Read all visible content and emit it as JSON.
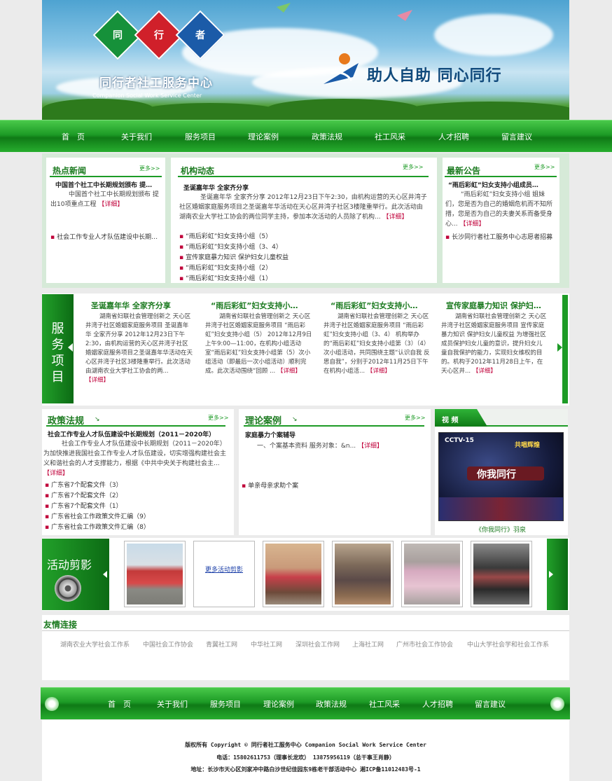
{
  "banner": {
    "logo_chars": [
      "同",
      "行",
      "者"
    ],
    "logo_cn": "同行者社工服务中心",
    "logo_en": "Companion Social Work Service Center",
    "slogan": "助人自助  同心同行"
  },
  "nav": {
    "items": [
      "首　页",
      "关于我们",
      "服务项目",
      "理论案例",
      "政策法规",
      "社工风采",
      "人才招聘",
      "留言建议"
    ]
  },
  "nav2": {
    "items": [
      "首　页",
      "关于我们",
      "服务项目",
      "理论案例",
      "政策法规",
      "社工风采",
      "人才招聘",
      "留言建议"
    ]
  },
  "more": "更多>>",
  "hot_news": {
    "title": "热点新闻",
    "headline": "中国首个社工中长期规划颁布  提…",
    "summary": "中国首个社工中长期规划颁布 提出10项重点工程",
    "detail": "【详细】",
    "items": [
      "社会工作专业人才队伍建设中长期…"
    ]
  },
  "org_news": {
    "title": "机构动态",
    "headline": "圣诞嘉年华  全家齐分享",
    "summary": "圣诞嘉年华  全家齐分享    2012年12月23日下午2:30，由机构运营的天心区井湾子社区婚姻家庭服务项目之圣诞嘉年华活动在天心区井湾子社区3楼隆重举行。此次活动由湖南农业大学社工协会的两位同学主持，参加本次活动的人员除了机构...",
    "detail": "【详细】",
    "items": [
      "“雨后彩虹”妇女支持小组（5）",
      "“雨后彩虹”妇女支持小组（3、4）",
      "宣传家庭暴力知识  保护妇女儿童权益",
      "“雨后彩虹”妇女支持小组（2）",
      "“雨后彩虹”妇女支持小组（1）"
    ]
  },
  "notice": {
    "title": "最新公告",
    "headline": "“雨后彩虹”妇女支持小组成员…",
    "summary": "“雨后彩虹”妇女支持小组  姐妹们，您是否为自己的婚姻危机而不知所措，您是否为自己的夫妻关系而备受身心...",
    "detail": "【详细】",
    "items": [
      "长沙同行者社工服务中心志愿者招募"
    ]
  },
  "services": {
    "label": "服务项目",
    "cards": [
      {
        "title": "圣诞嘉年华  全家齐分享",
        "text": "湖南省妇联社会管理创新之 天心区井湾子社区婚姻家庭服务项目 圣诞嘉年华   全家齐分享  2012年12月23日下午2:30，由机构运营的天心区井湾子社区婚姻家庭服务项目之圣诞嘉年华活动在天心区井湾子社区3楼隆重举行。此次活动由湖南农业大学社工协会的两...",
        "detail": "【详细】"
      },
      {
        "title": "“雨后彩虹”妇女支持小…",
        "text": "湖南省妇联社会管理创新之 天心区井湾子社区婚姻家庭服务项目 “雨后彩虹”妇女支持小组（5） 2012年12月9日上午9:00—11:00，在机构小组活动室“雨后彩虹”妇女支持小组第（5）次小组活动（即最后一次小组活动）顺利完成。此次活动围绕“回顾 ...",
        "detail": "【详细】"
      },
      {
        "title": "“雨后彩虹”妇女支持小…",
        "text": "湖南省妇联社会管理创新之 天心区井湾子社区婚姻家庭服务项目 “雨后彩虹”妇女支持小组（3、4） 机构举办的“雨后彩虹”妇女支持小组第（3）（4）次小组活动，共同围绕主题“认识自我  反思自我”，分别于2012年11月25日下午在机构小组活...",
        "detail": "【详细】"
      },
      {
        "title": "宣传家庭暴力知识  保护妇…",
        "text": "湖南省妇联社会管理创新之 天心区井湾子社区婚姻家庭服务项目 宣传家庭暴力知识      保护妇女儿童权益 为增强社区成员保护妇女儿童的意识，提升妇女儿童自我保护的能力，实现妇女维权的目的。机构于2012年11月28日上午，在天心区井...",
        "detail": "【详细】"
      }
    ]
  },
  "policy": {
    "title": "政策法规",
    "headline": "社会工作专业人才队伍建设中长期规划（2011－2020年）",
    "summary": "社会工作专业人才队伍建设中长期规划（2011－2020年）    为加快推进我国社会工作专业人才队伍建设，切实增强构建社会主义和谐社会的人才支撑能力，根据《中共中央关于构建社会主...",
    "detail": "【详细】",
    "items": [
      "广东省7个配套文件（3）",
      "广东省7个配套文件（2）",
      "广东省7个配套文件（1）",
      "广东省社会工作政策文件汇编（9）",
      "广东省社会工作政策文件汇编（8）"
    ]
  },
  "cases": {
    "title": "理论案例",
    "headline": "家庭暴力个案辅导",
    "summary": "一、个案基本资料  服务对象：&n...",
    "detail": "【详细】",
    "items": [
      "单亲母亲求助个案"
    ]
  },
  "video": {
    "title": "视  频",
    "tv_logo": "CCTV-15",
    "show_title": "共唱辉煌",
    "stage_text": "你我同行",
    "caption": "《你我同行》羽泉"
  },
  "gallery": {
    "label": "活动剪影",
    "more_link": "更多活动剪影"
  },
  "friends": {
    "title": "友情连接",
    "links": [
      "湖南农业大学社会工作系",
      "中国社会工作协会",
      "青翼社工网",
      "中华社工网",
      "深圳社会工作网",
      "上海社工网",
      "广州市社会工作协会",
      "中山大学社会学和社会工作系"
    ]
  },
  "footer": {
    "copyright": "版权所有 Copyright © 同行者社工服务中心 Companion Social Work Service Center",
    "phone": "电话：15802611753（理事长龙欢）   13875956119（总干事王肖静）",
    "address": "地址：长沙市天心区刘家冲中路白沙世纪佳园东9栋老干部活动中心   湘ICP备11012483号-1"
  },
  "colors": {
    "green": "#1d9b26",
    "red": "#c0003a",
    "title_green": "#1b7a1f"
  }
}
